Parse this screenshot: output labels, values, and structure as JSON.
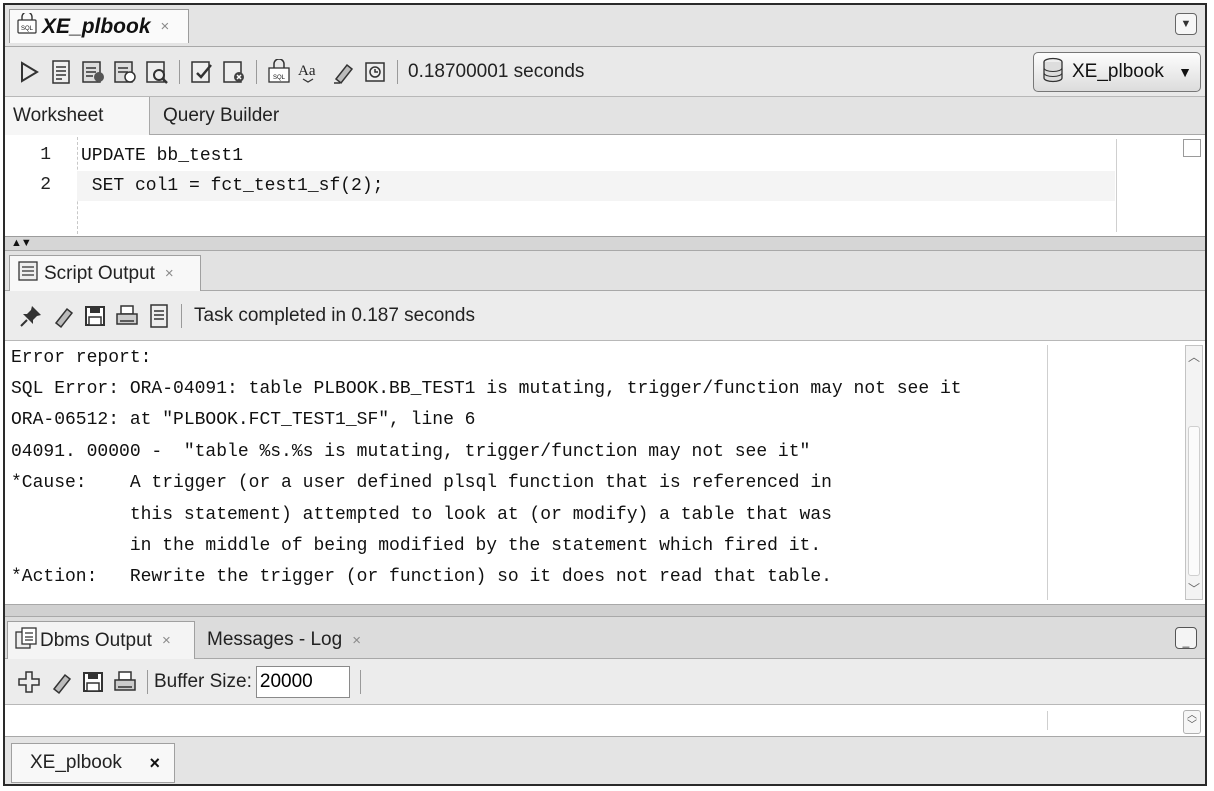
{
  "document_tab": {
    "label": "XE_plbook",
    "close": "×"
  },
  "toolbar": {
    "timing": "0.18700001 seconds",
    "connection": "XE_plbook",
    "connection_arrow": "▼"
  },
  "worksheet_tabs": [
    {
      "label": "Worksheet"
    },
    {
      "label": "Query Builder"
    }
  ],
  "editor": {
    "lines": [
      {
        "num": "1",
        "text": "UPDATE bb_test1"
      },
      {
        "num": "2",
        "text": " SET col1 = fct_test1_sf(2);"
      }
    ]
  },
  "script_output": {
    "tab_label": "Script Output",
    "close": "×",
    "status": "Task completed in 0.187 seconds",
    "lines": [
      "Error report:",
      "SQL Error: ORA-04091: table PLBOOK.BB_TEST1 is mutating, trigger/function may not see it",
      "ORA-06512: at \"PLBOOK.FCT_TEST1_SF\", line 6",
      "04091. 00000 -  \"table %s.%s is mutating, trigger/function may not see it\"",
      "*Cause:    A trigger (or a user defined plsql function that is referenced in",
      "           this statement) attempted to look at (or modify) a table that was",
      "           in the middle of being modified by the statement which fired it.",
      "*Action:   Rewrite the trigger (or function) so it does not read that table."
    ]
  },
  "dbms_output": {
    "tabs": [
      {
        "label": "Dbms Output",
        "close": "×"
      },
      {
        "label": "Messages - Log",
        "close": "×"
      }
    ],
    "buffer_label": "Buffer Size:",
    "buffer_value": "20000"
  },
  "connection_tab": {
    "label": "XE_plbook",
    "close": "×"
  }
}
